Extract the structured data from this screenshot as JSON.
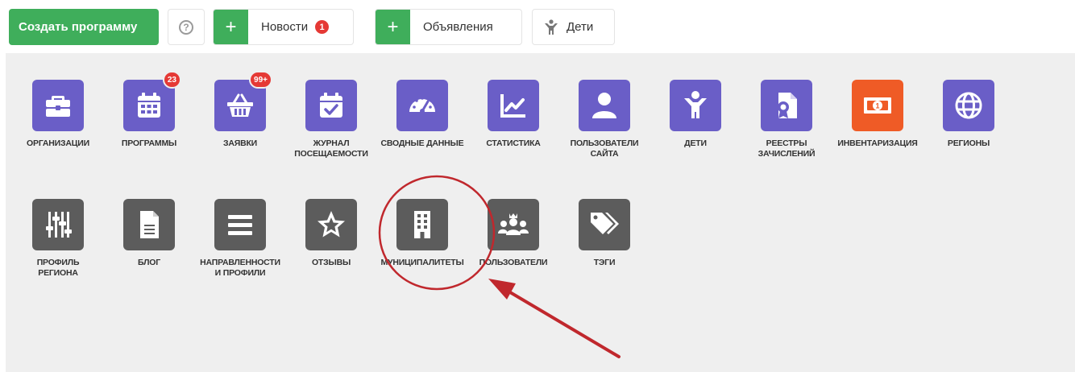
{
  "toolbar": {
    "create_label": "Создать программу",
    "help_glyph": "?",
    "news_plus": "+",
    "news_label": "Новости",
    "news_badge": "1",
    "ads_plus": "+",
    "ads_label": "Объявления",
    "kids_label": "Дети",
    "accent_green": "#3fae5b",
    "badge_red": "#e53935"
  },
  "tiles": [
    {
      "label": "ОРГАНИЗАЦИИ",
      "icon": "briefcase-icon",
      "color": "#6a5ec7"
    },
    {
      "label": "ПРОГРАММЫ",
      "icon": "calendar-icon",
      "color": "#6a5ec7",
      "badge": "23"
    },
    {
      "label": "ЗАЯВКИ",
      "icon": "basket-icon",
      "color": "#6a5ec7",
      "badge": "99+"
    },
    {
      "label": "ЖУРНАЛ ПОСЕЩАЕМОСТИ",
      "icon": "calendar-check-icon",
      "color": "#6a5ec7"
    },
    {
      "label": "СВОДНЫЕ ДАННЫЕ",
      "icon": "gauge-icon",
      "color": "#6a5ec7"
    },
    {
      "label": "СТАТИСТИКА",
      "icon": "line-chart-icon",
      "color": "#6a5ec7"
    },
    {
      "label": "ПОЛЬЗОВАТЕЛИ САЙТА",
      "icon": "user-icon",
      "color": "#6a5ec7"
    },
    {
      "label": "ДЕТИ",
      "icon": "child-icon",
      "color": "#6a5ec7"
    },
    {
      "label": "РЕЕСТРЫ ЗАЧИСЛЕНИЙ",
      "icon": "certificate-icon",
      "color": "#6a5ec7"
    },
    {
      "label": "ИНВЕНТАРИЗАЦИЯ",
      "icon": "money-bill-icon",
      "color": "#ef5b26"
    },
    {
      "label": "РЕГИОНЫ",
      "icon": "globe-icon",
      "color": "#6a5ec7"
    },
    {
      "label": "ПРОФИЛЬ РЕГИОНА",
      "icon": "sliders-icon",
      "color": "#5c5c5c"
    },
    {
      "label": "БЛОГ",
      "icon": "document-icon",
      "color": "#5c5c5c"
    },
    {
      "label": "НАПРАВЛЕННОСТИ И ПРОФИЛИ",
      "icon": "list-icon",
      "color": "#5c5c5c"
    },
    {
      "label": "ОТЗЫВЫ",
      "icon": "star-icon",
      "color": "#5c5c5c"
    },
    {
      "label": "МУНИЦИПАЛИТЕТЫ",
      "icon": "building-icon",
      "color": "#5c5c5c"
    },
    {
      "label": "ПОЛЬЗОВАТЕЛИ",
      "icon": "users-icon",
      "color": "#5c5c5c"
    },
    {
      "label": "ТЭГИ",
      "icon": "tags-icon",
      "color": "#5c5c5c"
    }
  ],
  "annotation": {
    "circle_color": "#c0282d",
    "arrow_color": "#c0282d"
  }
}
